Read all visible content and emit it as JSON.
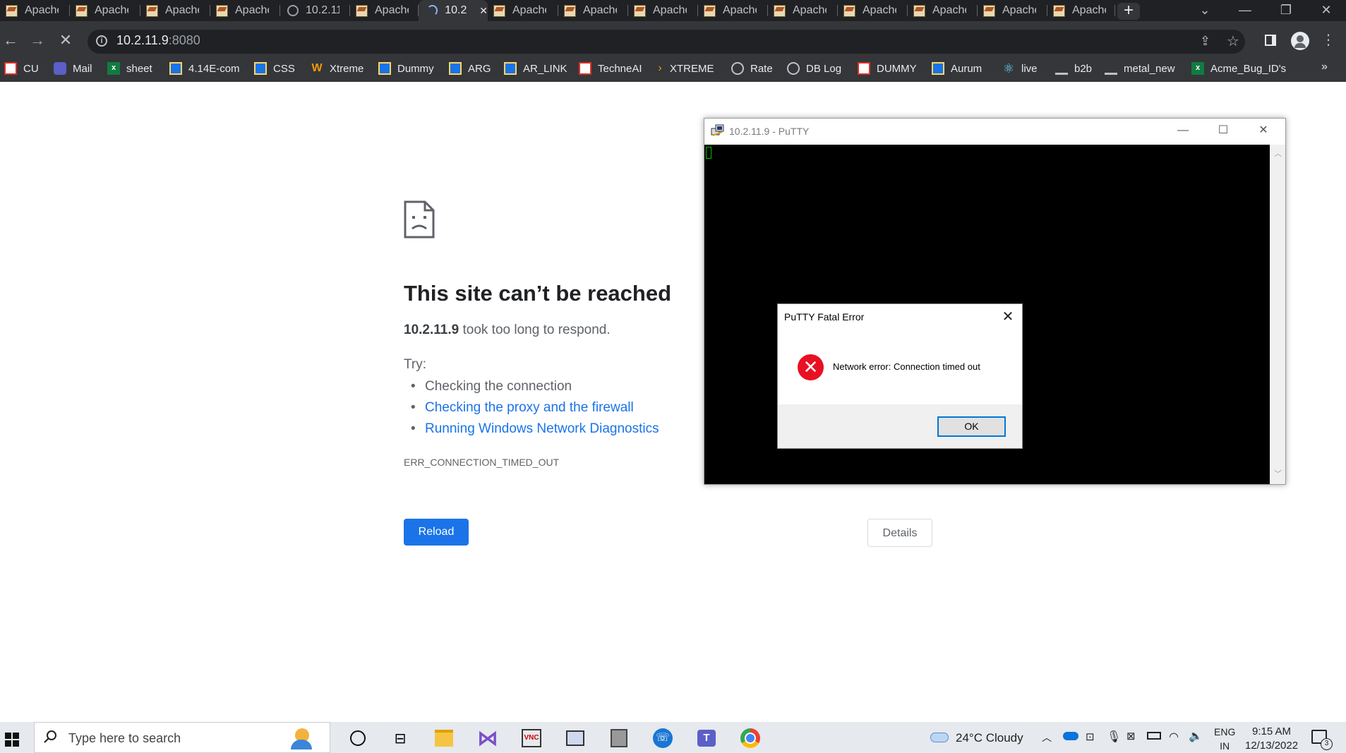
{
  "browser": {
    "tabs": [
      {
        "label": "Apache",
        "icon": "apache-icon"
      },
      {
        "label": "Apache",
        "icon": "apache-icon"
      },
      {
        "label": "Apache",
        "icon": "apache-icon"
      },
      {
        "label": "Apache",
        "icon": "apache-icon"
      },
      {
        "label": "10.2.11",
        "icon": "globe-icon"
      },
      {
        "label": "Apache",
        "icon": "apache-icon"
      },
      {
        "label": "10.2",
        "icon": "loading-spinner-icon",
        "active": true
      },
      {
        "label": "Apache",
        "icon": "apache-icon"
      },
      {
        "label": "Apache",
        "icon": "apache-icon"
      },
      {
        "label": "Apache",
        "icon": "apache-icon"
      },
      {
        "label": "Apache",
        "icon": "apache-icon"
      },
      {
        "label": "Apache",
        "icon": "apache-icon"
      },
      {
        "label": "Apache",
        "icon": "apache-icon"
      },
      {
        "label": "Apache",
        "icon": "apache-icon"
      },
      {
        "label": "Apache",
        "icon": "apache-icon"
      },
      {
        "label": "Apache",
        "icon": "apache-icon"
      }
    ],
    "address": {
      "host": "10.2.11.9",
      "port": ":8080"
    },
    "bookmarks": [
      {
        "label": "CU",
        "icon": "jira"
      },
      {
        "label": "Mail",
        "icon": "hex"
      },
      {
        "label": "sheet",
        "icon": "excel"
      },
      {
        "label": "4.14E-com",
        "icon": "grid"
      },
      {
        "label": "CSS",
        "icon": "grid"
      },
      {
        "label": "Xtreme",
        "icon": "w"
      },
      {
        "label": "Dummy",
        "icon": "grid"
      },
      {
        "label": "ARG",
        "icon": "grid"
      },
      {
        "label": "AR_LINK",
        "icon": "grid"
      },
      {
        "label": "TechneAI",
        "icon": "jira"
      },
      {
        "label": "XTREME",
        "icon": "arrow"
      },
      {
        "label": "Rate",
        "icon": "globe2"
      },
      {
        "label": "DB Log",
        "icon": "globe2"
      },
      {
        "label": "DUMMY",
        "icon": "jira"
      },
      {
        "label": "Aurum",
        "icon": "grid"
      },
      {
        "label": "live",
        "icon": "react"
      },
      {
        "label": "b2b",
        "icon": "bar"
      },
      {
        "label": "metal_new",
        "icon": "bar"
      },
      {
        "label": "Acme_Bug_ID's",
        "icon": "excel"
      }
    ],
    "more_bookmarks": "»"
  },
  "error_page": {
    "title": "This site can’t be reached",
    "host": "10.2.11.9",
    "message": " took too long to respond.",
    "try_label": "Try:",
    "suggestions": [
      {
        "text": "Checking the connection",
        "link": false
      },
      {
        "text": "Checking the proxy and the firewall",
        "link": true
      },
      {
        "text": "Running Windows Network Diagnostics",
        "link": true
      }
    ],
    "error_code": "ERR_CONNECTION_TIMED_OUT",
    "reload_label": "Reload",
    "details_label": "Details"
  },
  "putty": {
    "title": "10.2.11.9 - PuTTY",
    "dialog": {
      "title": "PuTTY Fatal Error",
      "message": "Network error: Connection timed out",
      "ok_label": "OK"
    }
  },
  "taskbar": {
    "search_placeholder": "Type here to search",
    "weather": "24°C  Cloudy",
    "lang_top": "ENG",
    "lang_bottom": "IN",
    "time": "9:15 AM",
    "date": "12/13/2022",
    "notification_count": "3"
  },
  "colors": {
    "tabstrip": "#202124",
    "toolbar": "#35363a",
    "link": "#1a73e8",
    "reload": "#1a73e8",
    "error_red": "#e81123"
  }
}
